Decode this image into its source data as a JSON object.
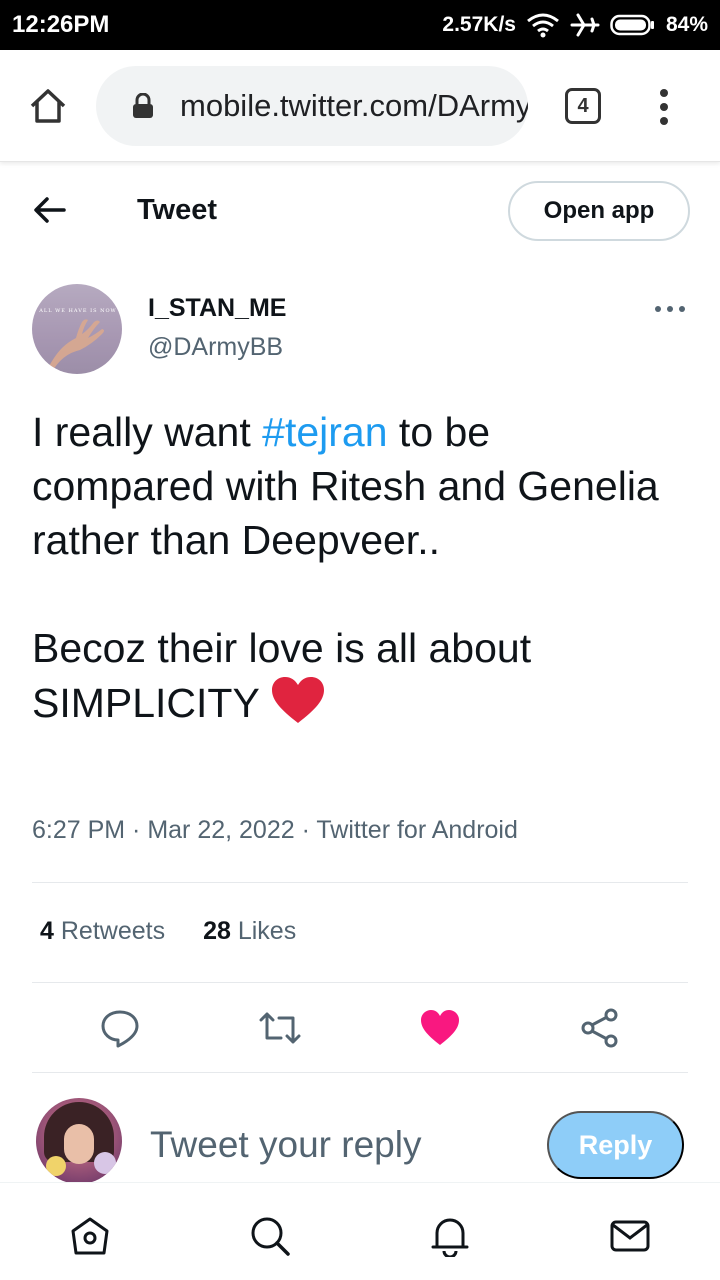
{
  "status_bar": {
    "time": "12:26PM",
    "network_speed": "2.57K/s",
    "battery": "84%",
    "icons": [
      "wifi-icon",
      "airplane-icon",
      "battery-icon"
    ]
  },
  "browser": {
    "url": "mobile.twitter.com/DArmyBB",
    "tab_count": "4",
    "icons": [
      "home-icon",
      "lock-icon",
      "tabs-icon",
      "more-vert-icon"
    ]
  },
  "header": {
    "title": "Tweet",
    "open_app_label": "Open app"
  },
  "tweet": {
    "author_name": "I_STAN_ME",
    "author_handle": "@DArmyBB",
    "avatar_text": "ALL WE HAVE IS NOW",
    "text_before_hashtag": "I really want ",
    "hashtag": "#tejran",
    "text_after_hashtag": " to be compared with Ritesh and Genelia rather than Deepveer..",
    "text_second_paragraph": "Becoz their love is all about SIMPLICITY",
    "emoji": "red-heart",
    "meta": "6:27 PM · Mar 22, 2022 · Twitter for Android",
    "retweets_count": "4",
    "retweets_label": "Retweets",
    "likes_count": "28",
    "likes_label": "Likes"
  },
  "actions": {
    "liked_color": "#f91880",
    "icons": [
      "reply-icon",
      "retweet-icon",
      "like-icon",
      "share-icon"
    ]
  },
  "reply": {
    "placeholder": "Tweet your reply",
    "button_label": "Reply"
  },
  "bottom_nav": {
    "icons": [
      "home-icon",
      "search-icon",
      "notifications-icon",
      "messages-icon"
    ]
  },
  "colors": {
    "accent": "#1d9bf0",
    "reply_button": "#8ecdf8",
    "secondary_text": "#536471"
  }
}
